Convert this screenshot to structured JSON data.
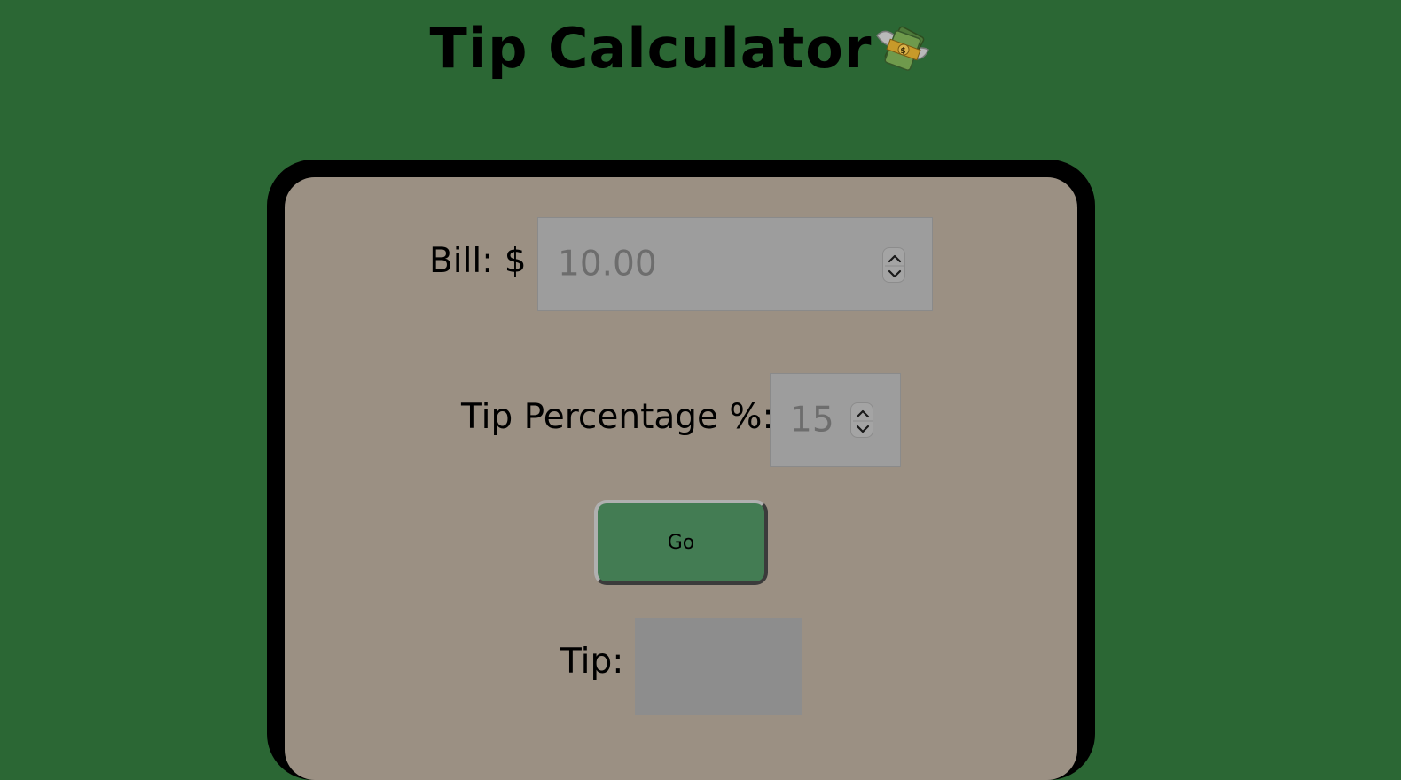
{
  "header": {
    "title": "Tip Calculator",
    "icon": "money-with-wings-icon"
  },
  "form": {
    "bill_label": "Bill: $",
    "bill_value": "10.00",
    "tip_percentage_label": "Tip Percentage %:",
    "tip_percentage_value": "15",
    "go_label": "Go",
    "tip_label": "Tip:",
    "tip_value": ""
  },
  "colors": {
    "background": "#2b6734",
    "card": "#9b9083",
    "card_border": "#000000",
    "input": "#9d9d9d",
    "button": "#437c53"
  }
}
